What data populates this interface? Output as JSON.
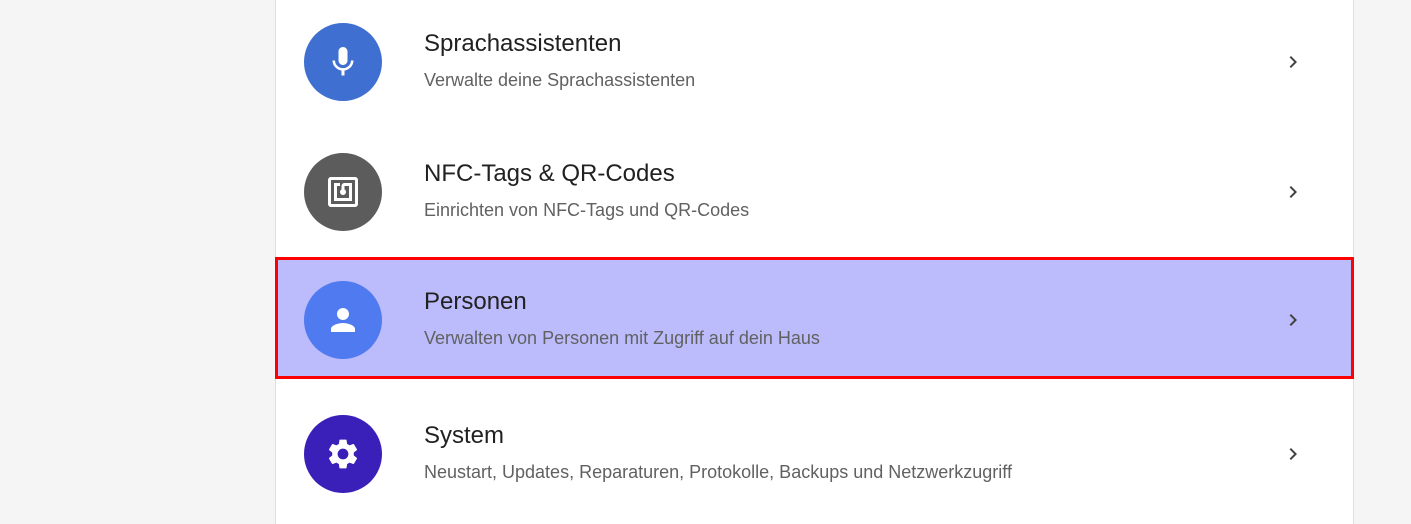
{
  "menu": {
    "items": [
      {
        "title": "Sprachassistenten",
        "subtitle": "Verwalte deine Sprachassistenten",
        "icon": "microphone-icon",
        "icon_color": "#3f6fd0"
      },
      {
        "title": "NFC-Tags & QR-Codes",
        "subtitle": "Einrichten von NFC-Tags und QR-Codes",
        "icon": "nfc-icon",
        "icon_color": "#5c5c5c"
      },
      {
        "title": "Personen",
        "subtitle": "Verwalten von Personen mit Zugriff auf dein Haus",
        "icon": "person-icon",
        "icon_color": "#4f7af0",
        "selected": true
      },
      {
        "title": "System",
        "subtitle": "Neustart, Updates, Reparaturen, Protokolle, Backups und Netzwerkzugriff",
        "icon": "gear-icon",
        "icon_color": "#3a1fb8"
      }
    ]
  }
}
